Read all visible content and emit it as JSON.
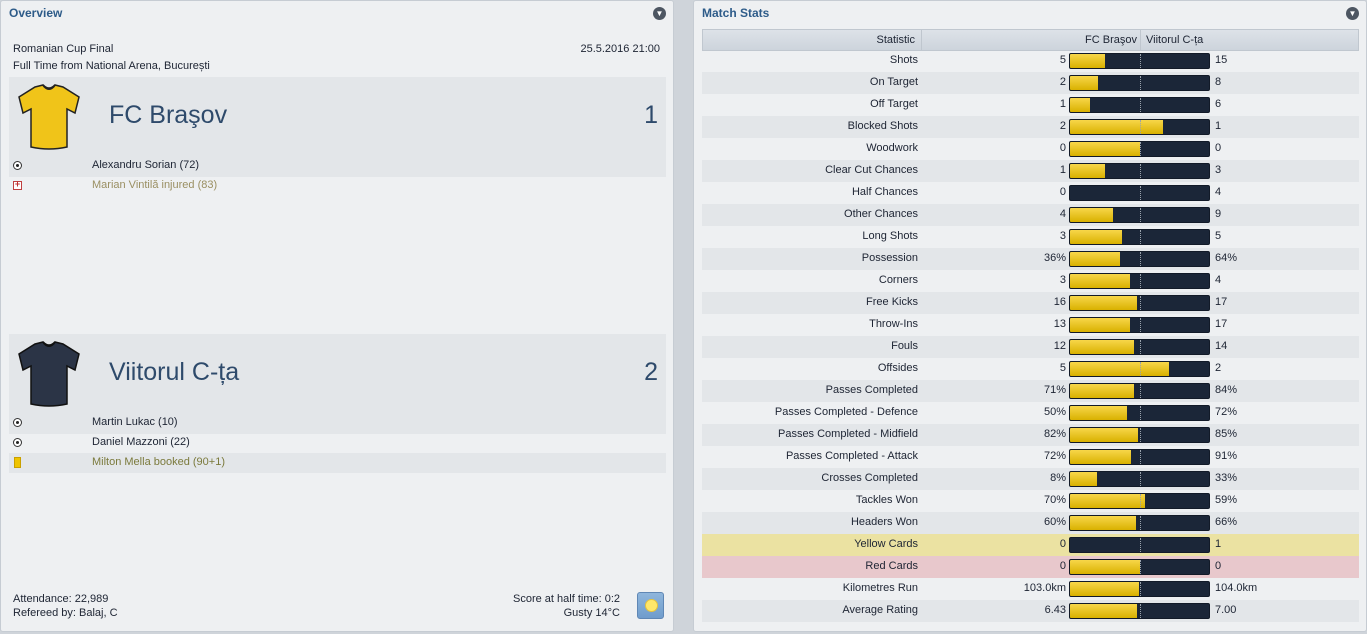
{
  "overview": {
    "title": "Overview",
    "competition": "Romanian Cup Final",
    "datetime": "25.5.2016 21:00",
    "status": "Full Time from National Arena, București",
    "home": {
      "name": "FC Braşov",
      "score": "1",
      "shirt_color": "#f0c419",
      "events": [
        {
          "type": "goal",
          "text": "Alexandru Sorian (72)"
        },
        {
          "type": "injury",
          "text": "Marian Vintilă injured (83)"
        }
      ]
    },
    "away": {
      "name": "Viitorul C-ța",
      "score": "2",
      "shirt_color": "#2b3446",
      "events": [
        {
          "type": "goal",
          "text": "Martin Lukac (10)"
        },
        {
          "type": "goal",
          "text": "Daniel Mazzoni (22)"
        },
        {
          "type": "booking",
          "text": "Milton Mella booked (90+1)"
        }
      ]
    },
    "attendance": "Attendance: 22,989",
    "referee": "Refereed by: Balaj, C",
    "half_time": "Score at half time: 0:2",
    "weather": "Gusty 14°C",
    "weather_icon": "sun-icon"
  },
  "stats": {
    "title": "Match Stats",
    "headers": {
      "statistic": "Statistic",
      "home": "FC Braşov",
      "away": "Viitorul C-ța"
    },
    "colors": {
      "home": "#f0c419",
      "away": "#1b2638"
    },
    "rows": [
      {
        "label": "Shots",
        "home": "5",
        "away": "15",
        "home_share": 0.25
      },
      {
        "label": "On Target",
        "home": "2",
        "away": "8",
        "home_share": 0.2
      },
      {
        "label": "Off Target",
        "home": "1",
        "away": "6",
        "home_share": 0.143
      },
      {
        "label": "Blocked Shots",
        "home": "2",
        "away": "1",
        "home_share": 0.667
      },
      {
        "label": "Woodwork",
        "home": "0",
        "away": "0",
        "home_share": 0.5
      },
      {
        "label": "Clear Cut Chances",
        "home": "1",
        "away": "3",
        "home_share": 0.25
      },
      {
        "label": "Half Chances",
        "home": "0",
        "away": "4",
        "home_share": 0
      },
      {
        "label": "Other Chances",
        "home": "4",
        "away": "9",
        "home_share": 0.308
      },
      {
        "label": "Long Shots",
        "home": "3",
        "away": "5",
        "home_share": 0.375
      },
      {
        "label": "Possession",
        "home": "36%",
        "away": "64%",
        "home_share": 0.36
      },
      {
        "label": "Corners",
        "home": "3",
        "away": "4",
        "home_share": 0.429
      },
      {
        "label": "Free Kicks",
        "home": "16",
        "away": "17",
        "home_share": 0.485
      },
      {
        "label": "Throw-Ins",
        "home": "13",
        "away": "17",
        "home_share": 0.433
      },
      {
        "label": "Fouls",
        "home": "12",
        "away": "14",
        "home_share": 0.462
      },
      {
        "label": "Offsides",
        "home": "5",
        "away": "2",
        "home_share": 0.714
      },
      {
        "label": "Passes Completed",
        "home": "71%",
        "away": "84%",
        "home_share": 0.458
      },
      {
        "label": "Passes Completed - Defence",
        "home": "50%",
        "away": "72%",
        "home_share": 0.41
      },
      {
        "label": "Passes Completed - Midfield",
        "home": "82%",
        "away": "85%",
        "home_share": 0.491
      },
      {
        "label": "Passes Completed - Attack",
        "home": "72%",
        "away": "91%",
        "home_share": 0.442
      },
      {
        "label": "Crosses Completed",
        "home": "8%",
        "away": "33%",
        "home_share": 0.195
      },
      {
        "label": "Tackles Won",
        "home": "70%",
        "away": "59%",
        "home_share": 0.543
      },
      {
        "label": "Headers Won",
        "home": "60%",
        "away": "66%",
        "home_share": 0.476
      },
      {
        "label": "Yellow Cards",
        "home": "0",
        "away": "1",
        "home_share": 0,
        "highlight": "yellow"
      },
      {
        "label": "Red Cards",
        "home": "0",
        "away": "0",
        "home_share": 0.5,
        "highlight": "red"
      },
      {
        "label": "Kilometres Run",
        "home": "103.0km",
        "away": "104.0km",
        "home_share": 0.498
      },
      {
        "label": "Average Rating",
        "home": "6.43",
        "away": "7.00",
        "home_share": 0.479
      }
    ]
  }
}
